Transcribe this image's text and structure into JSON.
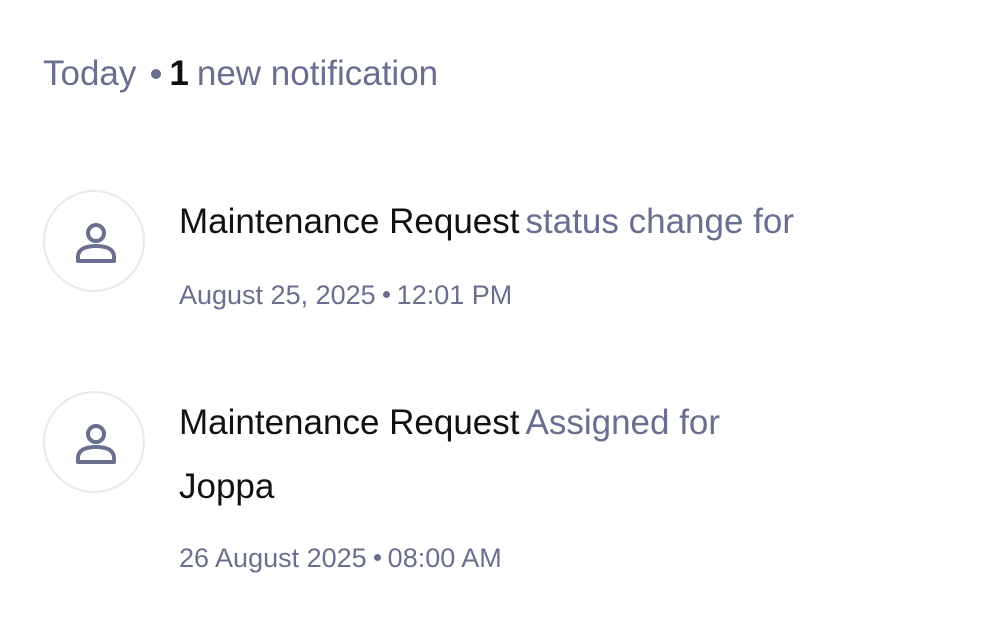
{
  "header": {
    "day_label": "Today",
    "new_count": "1",
    "new_label": "new notification"
  },
  "notifications": [
    {
      "icon": "user-icon",
      "subject": "Maintenance Request",
      "action": "status change for",
      "target": "",
      "date": "August 25, 2025",
      "time": "12:01 PM"
    },
    {
      "icon": "user-icon",
      "subject": "Maintenance Request",
      "action": "Assigned for",
      "target": "Joppa",
      "date": "26 August 2025",
      "time": "08:00 AM"
    }
  ],
  "colors": {
    "primary_text": "#111111",
    "muted_text": "#6b6f8f",
    "avatar_border": "#e8e8ee"
  }
}
